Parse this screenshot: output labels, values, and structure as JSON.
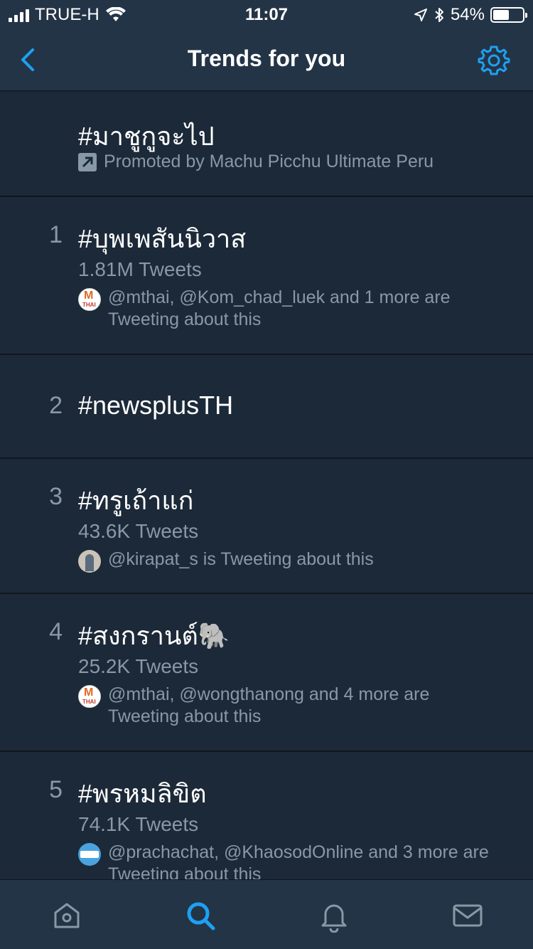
{
  "status_bar": {
    "carrier": "TRUE-H",
    "time": "11:07",
    "battery": "54%",
    "battery_level": 0.54
  },
  "header": {
    "title": "Trends for you",
    "back_icon": "chevron-left-icon",
    "settings_icon": "gear-icon",
    "accent_color": "#1da1f2"
  },
  "promoted": {
    "tag": "#มาชูกูจะไป",
    "label": "Promoted by Machu Picchu Ultimate Peru"
  },
  "trends": [
    {
      "rank": "1",
      "tag": "#บุพเพสันนิวาส",
      "count": "1.81M Tweets",
      "context": "@mthai, @Kom_chad_luek and 1 more are Tweeting about this",
      "avatar": "mthai"
    },
    {
      "rank": "2",
      "tag": "#newsplusTH"
    },
    {
      "rank": "3",
      "tag": "#ทรูเถ้าแก่",
      "count": "43.6K Tweets",
      "context": "@kirapat_s is Tweeting about this",
      "avatar": "kirapat"
    },
    {
      "rank": "4",
      "tag": "#สงกรานต์🐘",
      "count": "25.2K Tweets",
      "context": "@mthai, @wongthanong and 4 more are Tweeting about this",
      "avatar": "mthai"
    },
    {
      "rank": "5",
      "tag": "#พรหมลิขิต",
      "count": "74.1K Tweets",
      "context": "@prachachat, @KhaosodOnline and 3 more are Tweeting about this",
      "avatar": "prachachat"
    }
  ],
  "tab_bar": {
    "items": [
      "home-icon",
      "search-icon",
      "notifications-icon",
      "messages-icon"
    ],
    "active": "search-icon"
  },
  "colors": {
    "background": "#1c2938",
    "bar": "#243447",
    "secondary_text": "#8899a6"
  }
}
